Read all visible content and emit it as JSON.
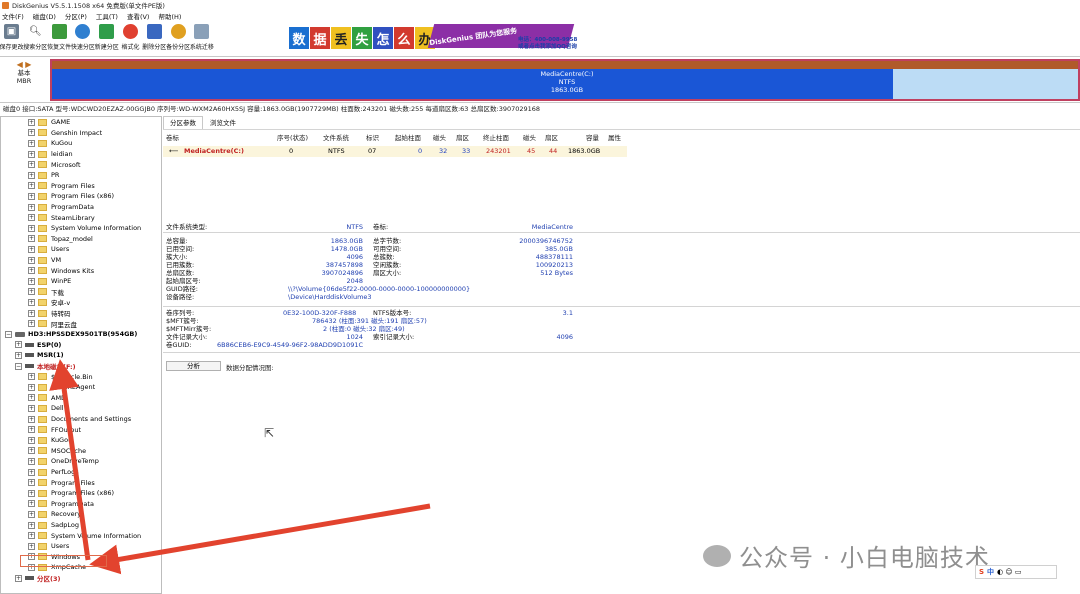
{
  "window": {
    "title": "DiskGenius V5.5.1.1508 x64 免费版(单文件PE版)"
  },
  "menu": [
    "文件(F)",
    "磁盘(D)",
    "分区(P)",
    "工具(T)",
    "查看(V)",
    "帮助(H)"
  ],
  "toolbar": [
    {
      "label": "保存更改",
      "icon": "save-icon"
    },
    {
      "label": "搜索分区",
      "icon": "search-partition-icon"
    },
    {
      "label": "恢复文件",
      "icon": "recover-file-icon"
    },
    {
      "label": "快速分区",
      "icon": "quick-partition-icon"
    },
    {
      "label": "新建分区",
      "icon": "new-partition-icon"
    },
    {
      "label": "格式化",
      "icon": "format-icon"
    },
    {
      "label": "删除分区",
      "icon": "delete-partition-icon"
    },
    {
      "label": "备份分区",
      "icon": "backup-partition-icon"
    },
    {
      "label": "系统迁移",
      "icon": "system-migrate-icon"
    }
  ],
  "promo": {
    "chars": [
      "数",
      "据",
      "丢",
      "失",
      "怎",
      "么",
      "办"
    ],
    "banner": "DiskGenius 团队为您服务",
    "phone": "电话：400-008-9958",
    "qq": "或者点击我添加QQ咨询"
  },
  "diskmap": {
    "label_1": "基本",
    "label_2": "MBR",
    "partition_name": "MediaCentre(C:)",
    "fs": "NTFS",
    "size": "1863.0GB",
    "used_fraction": 0.82
  },
  "disk_line": "磁盘0 接口:SATA  型号:WDCWD20EZAZ-00GGJB0  序列号:WD-WXM2A60HX5SJ  容量:1863.0GB(1907729MB)  柱面数:243201  磁头数:255  每道扇区数:63  总扇区数:3907029168",
  "tree": {
    "top_folders": [
      "GAME",
      "Genshin Impact",
      "KuGou",
      "leidian",
      "Microsoft",
      "PR",
      "Program Files",
      "Program Files (x86)",
      "ProgramData",
      "SteamLibrary",
      "System Volume Information",
      "Topaz_model",
      "Users",
      "VM",
      "Windows Kits",
      "WinPE",
      "下载",
      "安卓-v",
      "待转码",
      "阿里云盘"
    ],
    "disk2": "HD3:HPSSDEX9501TB(954GB)",
    "esp": "ESP(0)",
    "msr": "MSR(1)",
    "local": "本地磁盘(F:)",
    "sub_folders": [
      "$Recycle.Bin",
      "$WinREAgent",
      "AMD",
      "Dell",
      "Documents and Settings",
      "FFOutput",
      "KuGou",
      "MSOCache",
      "OneDriveTemp",
      "PerfLogs",
      "Program Files",
      "Program Files (x86)",
      "ProgramData",
      "Recovery",
      "SadpLog",
      "System Volume Information",
      "Users",
      "Windows",
      "XmpCache"
    ],
    "last": "分区(3)"
  },
  "tabs": [
    "分区参数",
    "浏览文件"
  ],
  "table": {
    "headers": [
      "卷标",
      "序号(状态)",
      "文件系统",
      "标识",
      "起始柱面",
      "磁头",
      "扇区",
      "终止柱面",
      "磁头",
      "扇区",
      "容量",
      "属性"
    ],
    "row": [
      "MediaCentre(C:)",
      "0",
      "NTFS",
      "07",
      "0",
      "32",
      "33",
      "243201",
      "45",
      "44",
      "1863.0GB",
      ""
    ]
  },
  "details": {
    "fs_type_label": "文件系统类型:",
    "fs_type": "NTFS",
    "vol_label_label": "卷标:",
    "vol_label": "MediaCentre",
    "total_label": "总容量:",
    "total": "1863.0GB",
    "total_bytes_label": "总字节数:",
    "total_bytes": "2000396746752",
    "used_label": "已用空间:",
    "used": "1478.0GB",
    "free_label": "可用空间:",
    "free": "385.0GB",
    "cluster_label": "簇大小:",
    "cluster": "4096",
    "clusters_label": "总簇数:",
    "clusters": "488378111",
    "used_clusters_label": "已用簇数:",
    "used_clusters": "387457898",
    "free_clusters_label": "空闲簇数:",
    "free_clusters": "100920213",
    "sectors_label": "总扇区数:",
    "sectors": "3907024896",
    "sector_size_label": "扇区大小:",
    "sector_size": "512 Bytes",
    "start_sector_label": "起始扇区号:",
    "start_sector": "2048",
    "guid_path_label": "GUID路径:",
    "guid_path": "\\\\?\\Volume{06de5f22-0000-0000-0000-100000000000}",
    "device_path_label": "设备路径:",
    "device_path": "\\Device\\HarddiskVolume3",
    "serial_label": "卷序列号:",
    "serial": "0E32-100D-320F-F888",
    "ntfs_ver_label": "NTFS版本号:",
    "ntfs_ver": "3.1",
    "mft_label": "$MFT簇号:",
    "mft": "786432 (柱面:391 磁头:191 扇区:57)",
    "mftmirr_label": "$MFTMirr簇号:",
    "mftmirr": "2 (柱面:0 磁头:32 扇区:49)",
    "frs_label": "文件记录大小:",
    "frs": "1024",
    "irs_label": "索引记录大小:",
    "irs": "4096",
    "vguid_label": "卷GUID:",
    "vguid": "6B86CEB6-E9C9-4549-96F2-98ADD9D1091C"
  },
  "analyze": {
    "button": "分析",
    "note": "数据分配情况图:"
  },
  "watermark": "公众号 · 小白电脑技术",
  "ime": {
    "s": "S",
    "z": "中"
  }
}
